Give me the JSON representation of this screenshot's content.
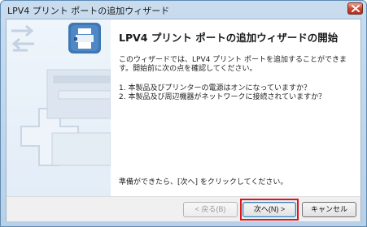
{
  "window": {
    "title": "LPV4 プリント ポートの追加ウィザード",
    "close_icon": "close-x-icon"
  },
  "side_panel": {
    "icons": [
      "arrows-exchange-icon",
      "printer-port-icon",
      "large-plus-icon",
      "printer-device-icon"
    ]
  },
  "content": {
    "heading": "LPV4 プリント ポートの追加ウィザードの開始",
    "intro": "このウィザードでは、LPV4 プリント ポートを追加することができます。開始前に次の点を確認してください。",
    "checklist": [
      "1. 本製品及びプリンターの電源はオンになっていますか？",
      "2. 本製品及び周辺機器がネットワークに接続されていますか？"
    ],
    "footer_note": "準備ができたら、[次へ] をクリックしてください。"
  },
  "buttons": {
    "back": "< 戻る(B)",
    "next": "次へ(N) >",
    "cancel": "キャンセル"
  },
  "colors": {
    "highlight": "#e0141b",
    "titlebar": "#c9dcee",
    "close": "#c9442f"
  }
}
